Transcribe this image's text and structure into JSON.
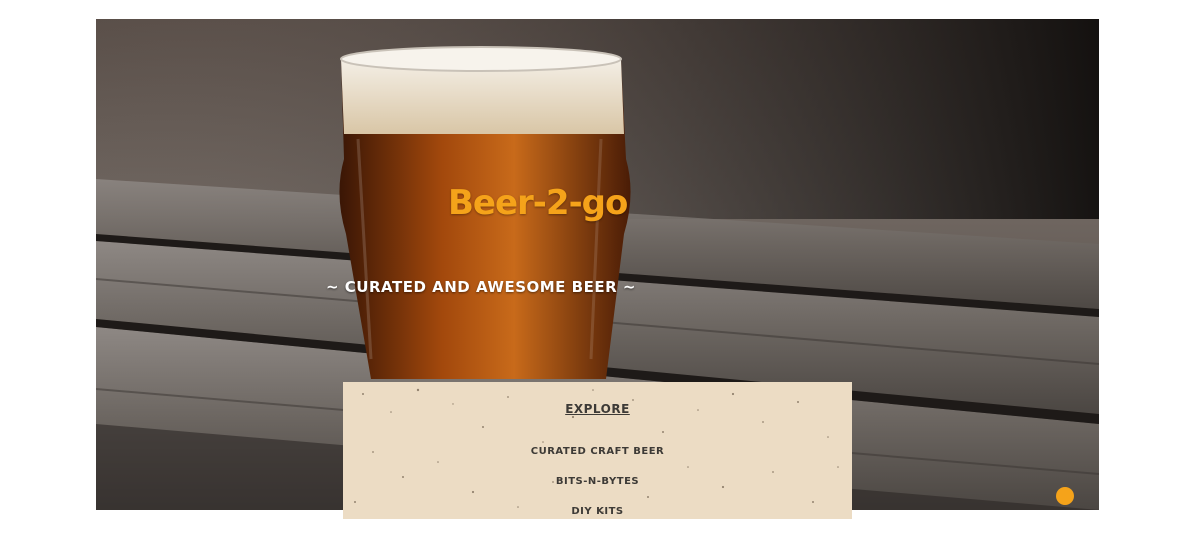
{
  "hero": {
    "title": "Beer-2-go",
    "subtitle": "~ Curated and Awesome Beer ~",
    "image_icon": "beer-glass-on-table-photo"
  },
  "explore": {
    "heading": "Explore",
    "links": [
      {
        "label": "Curated Craft Beer"
      },
      {
        "label": "Bits-n-Bytes"
      },
      {
        "label": "DIY Kits"
      }
    ]
  },
  "fab": {
    "icon": "circle-button-icon",
    "color": "#f5a31a"
  },
  "colors": {
    "accent": "#f5a31a",
    "panel": "#ecdcc4",
    "panel_text": "#3d3a36"
  }
}
